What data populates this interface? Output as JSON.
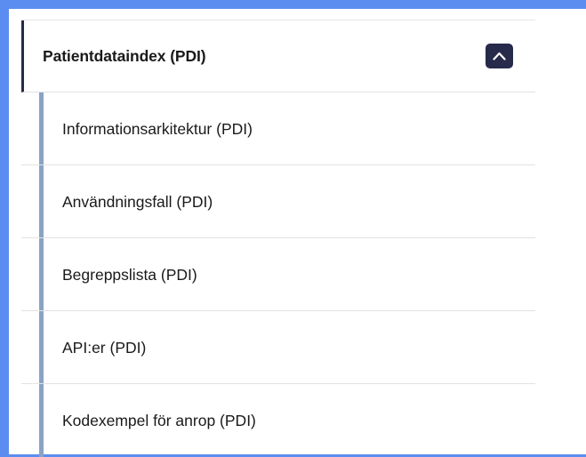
{
  "nav": {
    "header": {
      "title": "Patientdataindex (PDI)",
      "expanded": true,
      "toggle_icon": "chevron-up-icon"
    },
    "items": [
      {
        "label": "Informationsarkitektur (PDI)"
      },
      {
        "label": "Användningsfall (PDI)"
      },
      {
        "label": "Begreppslista (PDI)"
      },
      {
        "label": "API:er (PDI)"
      },
      {
        "label": "Kodexempel för anrop (PDI)"
      }
    ]
  },
  "colors": {
    "background": "#5b8df0",
    "header_accent": "#272a4a",
    "item_accent": "#8aa3c4",
    "divider": "#e2e2e2",
    "text": "#1a1a1a"
  }
}
